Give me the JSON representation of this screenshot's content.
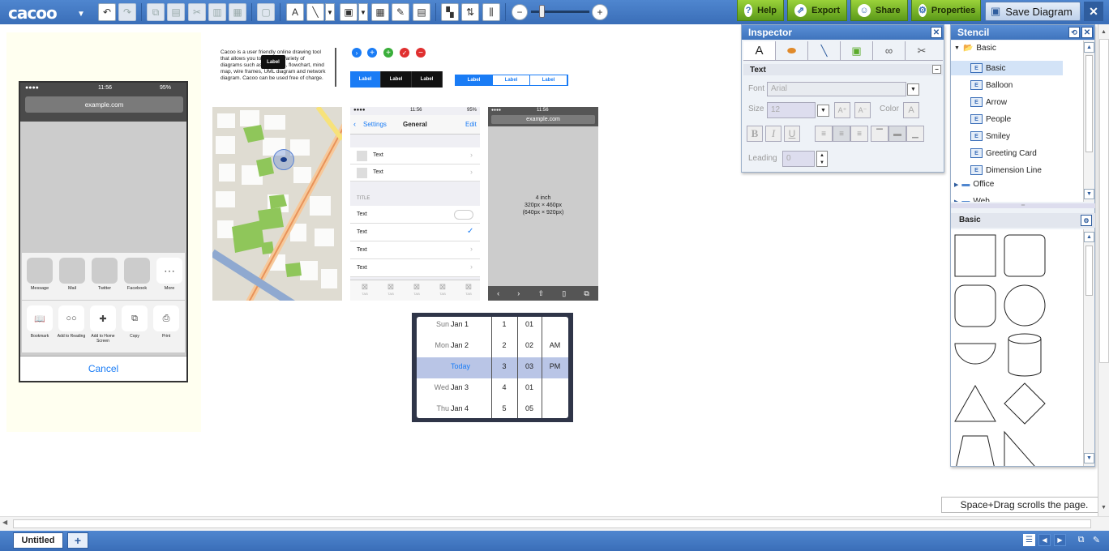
{
  "toolbar": {
    "logo": "cacoo",
    "help": "Help",
    "export": "Export",
    "share": "Share",
    "properties": "Properties",
    "save": "Save Diagram",
    "close": "✕"
  },
  "inspector": {
    "title": "Inspector",
    "section": "Text",
    "font_label": "Font",
    "font_value": "Arial",
    "size_label": "Size",
    "size_value": "12",
    "color_label": "Color",
    "leading_label": "Leading",
    "leading_value": "0"
  },
  "stencil": {
    "title": "Stencil",
    "tree_root": "Basic",
    "items": [
      "Basic",
      "Balloon",
      "Arrow",
      "People",
      "Smiley",
      "Greeting Card",
      "Dimension Line"
    ],
    "folders": [
      "Office",
      "Web"
    ],
    "library_title": "Basic"
  },
  "hint": "Space+Drag scrolls the page.",
  "tabs": {
    "current": "Untitled",
    "add": "+"
  },
  "mock_phone_1": {
    "signal": "●●●●",
    "time": "11:56",
    "battery": "95%",
    "url": "example.com",
    "share_apps": [
      "Message",
      "Mail",
      "Twitter",
      "Facebook",
      "More"
    ],
    "actions": [
      "Bookmark",
      "Add to Reading",
      "Add to Home Screen",
      "Copy",
      "Print"
    ],
    "cancel": "Cancel"
  },
  "text_block": {
    "body": "Cacoo is a user friendly online drawing tool that allows you to create a variety of diagrams such as site maps, flowchart, mind map, wire frames, UML diagram and network diagram. Cacoo can be used free of charge.",
    "tooltip": "Label"
  },
  "seg_dark": [
    "Label",
    "Label",
    "Label"
  ],
  "seg_light": [
    "Label",
    "Label",
    "Label"
  ],
  "settings_phone": {
    "time": "11:56",
    "battery": "95%",
    "back": "Settings",
    "title": "General",
    "edit": "Edit",
    "rows": [
      "Text",
      "Text"
    ],
    "section": "TITLE",
    "rows2": [
      "Text",
      "Text",
      "Text",
      "Text"
    ],
    "tab_label": "TAB"
  },
  "browser_phone": {
    "time": "11:56",
    "url": "example.com",
    "size1": "4 inch",
    "size2": "320px × 460px",
    "size3": "(640px × 920px)"
  },
  "picker": {
    "days": [
      "Sun",
      "Mon",
      "",
      "Wed",
      "Thu"
    ],
    "dates": [
      "Jan 1",
      "Jan 2",
      "Today",
      "Jan 3",
      "Jan 4"
    ],
    "hours": [
      "1",
      "2",
      "3",
      "4",
      "5"
    ],
    "minutes": [
      "01",
      "02",
      "03",
      "01",
      "05"
    ],
    "ampm": [
      "",
      "AM",
      "PM",
      "",
      ""
    ]
  },
  "colors": {
    "toolbar": "#3a6eb8",
    "accent_green": "#7bbb2a",
    "ios_blue": "#1a7cf5",
    "map_green": "#8fc65a",
    "map_road": "#f6c89a"
  }
}
